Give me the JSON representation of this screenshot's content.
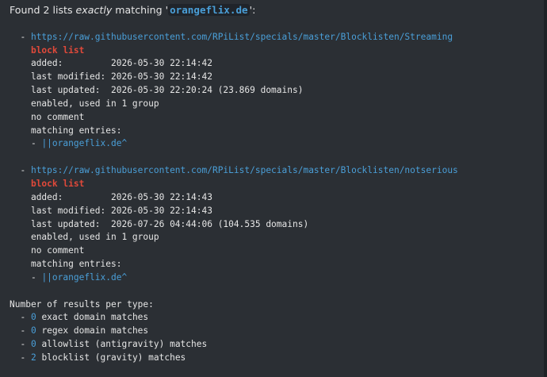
{
  "header": {
    "prefix": "Found 2 lists ",
    "emphasis": "exactly",
    "middle": " matching '",
    "domain": "orangeflix.de",
    "suffix": "':"
  },
  "lists": [
    {
      "dash": "  - ",
      "url": "https://raw.githubusercontent.com/RPiList/specials/master/Blocklisten/Streaming",
      "type": "block list",
      "added": "added:         2026-05-30 22:14:42",
      "modified": "last modified: 2026-05-30 22:14:42",
      "updated": "last updated:  2026-05-30 22:20:24 (23.869 domains)",
      "status": "enabled, used in 1 group",
      "comment": "no comment",
      "entries_label": "matching entries:",
      "entry_dash": "- ",
      "entry": "||orangeflix.de^"
    },
    {
      "dash": "  - ",
      "url": "https://raw.githubusercontent.com/RPiList/specials/master/Blocklisten/notserious",
      "type": "block list",
      "added": "added:         2026-05-30 22:14:43",
      "modified": "last modified: 2026-05-30 22:14:43",
      "updated": "last updated:  2026-07-26 04:44:06 (104.535 domains)",
      "status": "enabled, used in 1 group",
      "comment": "no comment",
      "entries_label": "matching entries:",
      "entry_dash": "- ",
      "entry": "||orangeflix.de^"
    }
  ],
  "summary": {
    "title": "Number of results per type:",
    "items": [
      {
        "dash": "  - ",
        "count": "0",
        "label": " exact domain matches"
      },
      {
        "dash": "  - ",
        "count": "0",
        "label": " regex domain matches"
      },
      {
        "dash": "  - ",
        "count": "0",
        "label": " allowlist (antigravity) matches"
      },
      {
        "dash": "  - ",
        "count": "2",
        "label": " blocklist (gravity) matches"
      }
    ]
  },
  "colors": {
    "background": "#2b2f34",
    "text": "#e6e6e6",
    "link": "#4a9fd8",
    "list_type": "#e0493a"
  }
}
